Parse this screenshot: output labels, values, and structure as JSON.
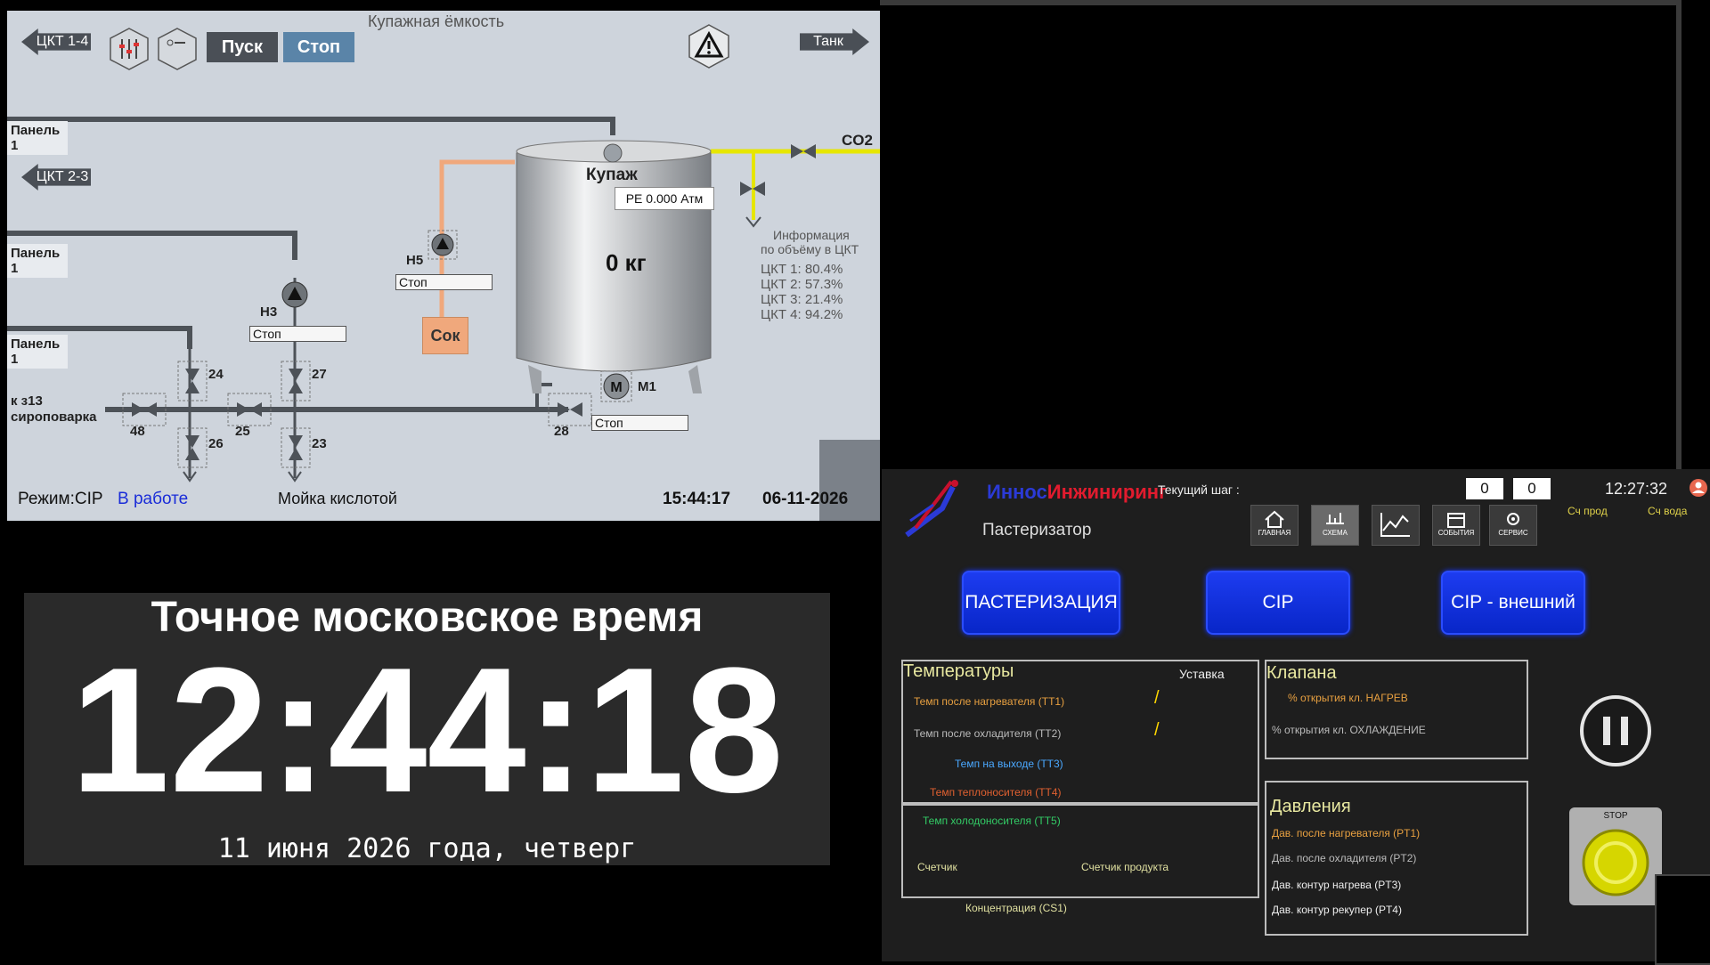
{
  "scada": {
    "nav_left_top": "ЦКТ 1-4",
    "nav_left_mid": "ЦКТ 2-3",
    "nav_right": "Танк",
    "start_label": "Пуск",
    "stop_label": "Стоп",
    "title": "Купажная ёмкость",
    "panel_labels": [
      "Панель 1",
      "Панель 1",
      "Панель 1"
    ],
    "line_label_1": "к з13",
    "line_label_2": "сироповарка",
    "co2_label": "CO2",
    "tank_label": "Купаж",
    "pressure": "PE 0.000 Атм",
    "weight": "0 кг",
    "juice_label": "Сок",
    "pumps": {
      "h5": "Н5",
      "h3": "Н3",
      "m1": "М1"
    },
    "status_h5": "Стоп",
    "status_h3": "Стоп",
    "status_m1": "Стоп",
    "valves": {
      "v24": "24",
      "v27": "27",
      "v48": "48",
      "v25": "25",
      "v26": "26",
      "v23": "23",
      "v28": "28"
    },
    "info_title_1": "Информация",
    "info_title_2": "по объёму в ЦКТ",
    "info_lines": [
      {
        "name": "ЦКТ 1:",
        "value": "80.4%"
      },
      {
        "name": "ЦКТ 2:",
        "value": "57.3%"
      },
      {
        "name": "ЦКТ 3:",
        "value": "21.4%"
      },
      {
        "name": "ЦКТ 4:",
        "value": "94.2%"
      }
    ],
    "mode_label": "Режим:CIP",
    "mode_state": "В работе",
    "process": "Мойка кислотой",
    "time": "15:44:17",
    "date": "06-11-2026"
  },
  "clock": {
    "title": "Точное московское время",
    "time": "12:44:18",
    "date": "11 июня 2026 года, четверг"
  },
  "hmi": {
    "brand_1": "Инжиниринг",
    "brand_blue": "Иннос",
    "subtitle": "Пастеризатор",
    "current_step_label": "Текущий шаг :",
    "counter_1": "0",
    "counter_2": "0",
    "time": "12:27:32",
    "sch_prod": "Сч прод",
    "sch_voda": "Сч вода",
    "icons": [
      "ГЛАВНАЯ",
      "СХЕМА",
      "",
      "СОБЫТИЯ",
      "СЕРВИС"
    ],
    "btn_past": "ПАСТЕРИЗАЦИЯ",
    "btn_cip": "CIP",
    "btn_cip_ext": "CIP - внешний",
    "temps_title": "Температуры",
    "setpoint": "Уставка",
    "tt1": "Темп после нагревателя (ТТ1)",
    "tt2": "Темп после охладителя (ТТ2)",
    "tt3": "Темп на выходе (ТТ3)",
    "tt4": "Темп теплоносителя (ТТ4)",
    "tt5": "Темп холодоносителя (ТТ5)",
    "slash": "/",
    "valves_title": "Клапана",
    "valve_heat": "% открытия кл. НАГРЕВ",
    "valve_cool": "% открытия кл. ОХЛАЖДЕНИЕ",
    "counter_lbl": "Счетчик",
    "counter_prod": "Счетчик продукта",
    "concentration": "Концентрация (CS1)",
    "press_title": "Давления",
    "pt1": "Дав. после нагревателя (PT1)",
    "pt2": "Дав. после охладителя (PT2)",
    "pt3": "Дав. контур нагрева (PT3)",
    "pt4": "Дав. контур рекупер (PT4)",
    "stop_btn": "STOP"
  },
  "colors": {
    "scada_bg": "#ced4dc",
    "hmi_bg": "#1e1e1e",
    "mode_blue": "#0826c8",
    "juice": "#f0a87c",
    "co2_line": "#e6e600"
  }
}
